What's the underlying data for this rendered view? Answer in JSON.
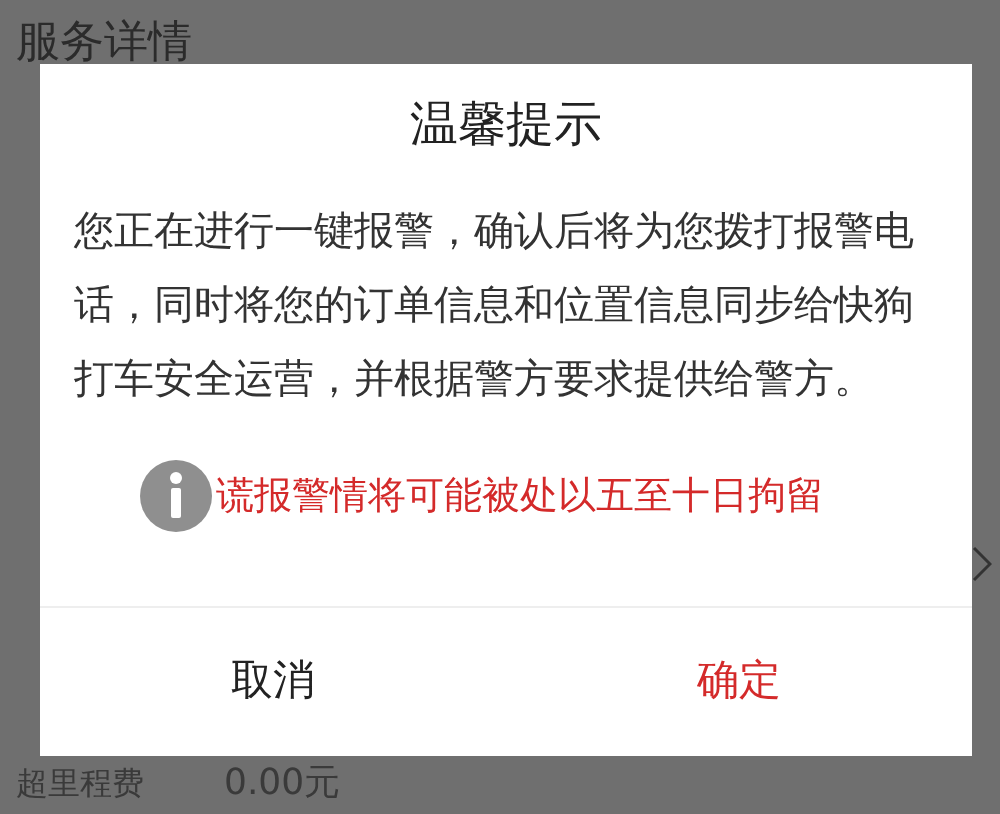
{
  "page": {
    "title": "服务详情",
    "last_row": {
      "label": "超里程费",
      "value": "0.00元"
    }
  },
  "dialog": {
    "title": "温馨提示",
    "message": "您正在进行一键报警，确认后将为您拨打报警电话，同时将您的订单信息和位置信息同步给快狗打车安全运营，并根据警方要求提供给警方。",
    "warning": "谎报警情将可能被处以五至十日拘留",
    "buttons": [
      {
        "label": "取消",
        "kind": "cancel"
      },
      {
        "label": "确定",
        "kind": "confirm"
      }
    ]
  }
}
